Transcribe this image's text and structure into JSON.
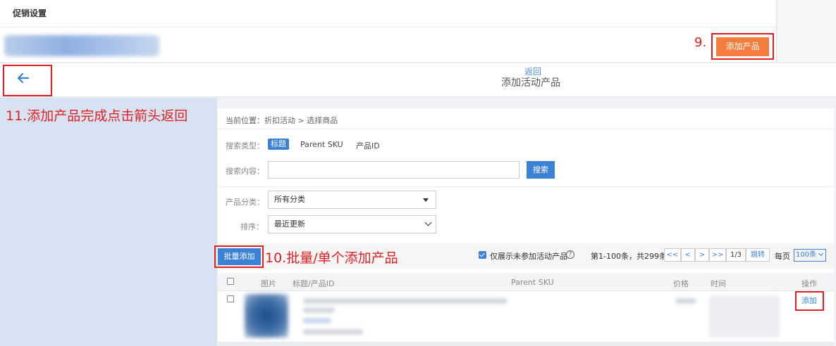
{
  "background_page": {
    "title": "促销设置",
    "add_product_button": "添加产品",
    "step9_label": "9."
  },
  "modal": {
    "back_link": "返回",
    "title": "添加活动产品",
    "step11_label": "11.添加产品完成点击箭头返回"
  },
  "breadcrumb": "当前位置：折扣活动 > 选择商品",
  "search": {
    "type_label": "搜索类型：",
    "type_options": [
      "标题",
      "Parent SKU",
      "产品ID"
    ],
    "content_label": "搜索内容：",
    "button": "搜索",
    "value": ""
  },
  "filters": {
    "category_label": "产品分类：",
    "category_value": "所有分类",
    "sort_label": "排序：",
    "sort_value": "最近更新"
  },
  "toolbar": {
    "batch_add": "批量添加",
    "step10_label": "10.批量/单个添加产品",
    "only_unjoined": "仅展示未参加活动产品",
    "help": "?",
    "page_range": "第1-100条，共299条",
    "pager": [
      "<<",
      "<",
      ">",
      ">>"
    ],
    "page_of": "1/3",
    "jump": "跳转",
    "per_page_label": "每页",
    "per_page_value": "100条"
  },
  "table": {
    "headers": [
      "图片",
      "标题/产品ID",
      "Parent SKU",
      "价格",
      "时间",
      "操作"
    ],
    "row_action": "添加"
  },
  "colors": {
    "accent": "#3b82d6",
    "orange_button": "#f47c3c",
    "annotation_red": "#e02020"
  }
}
